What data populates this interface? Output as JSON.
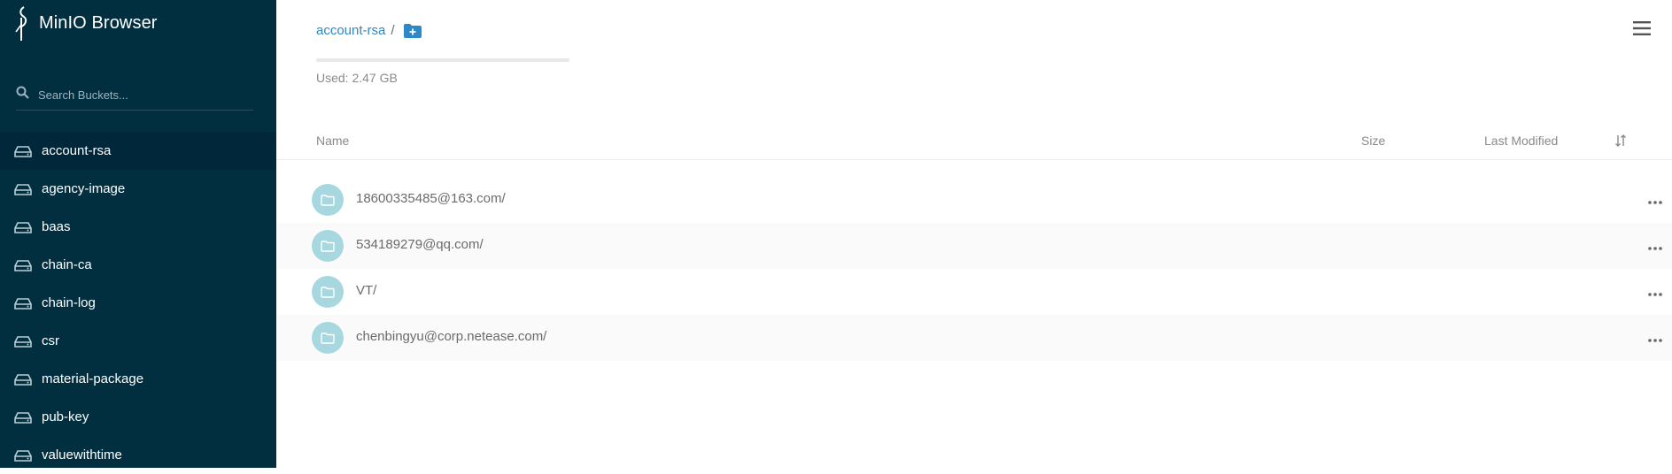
{
  "app": {
    "title": "MinIO Browser"
  },
  "search": {
    "placeholder": "Search Buckets..."
  },
  "sidebar": {
    "buckets": [
      {
        "label": "account-rsa",
        "active": true
      },
      {
        "label": "agency-image"
      },
      {
        "label": "baas"
      },
      {
        "label": "chain-ca"
      },
      {
        "label": "chain-log"
      },
      {
        "label": "csr"
      },
      {
        "label": "material-package"
      },
      {
        "label": "pub-key"
      },
      {
        "label": "valuewithtime"
      }
    ]
  },
  "breadcrumb": {
    "bucket": "account-rsa",
    "separator": "/"
  },
  "usage": {
    "text": "Used: 2.47 GB"
  },
  "table": {
    "headers": {
      "name": "Name",
      "size": "Size",
      "last_modified": "Last Modified"
    },
    "rows": [
      {
        "name": "18600335485@163.com/"
      },
      {
        "name": "534189279@qq.com/"
      },
      {
        "name": "VT/"
      },
      {
        "name": "chenbingyu@corp.netease.com/"
      }
    ]
  },
  "icons": {
    "logo": "minio-bird-icon",
    "search": "search-icon",
    "bucket": "bucket-drive-icon",
    "new_folder": "folder-plus-icon",
    "menu": "hamburger-menu-icon",
    "sort": "sort-icon",
    "folder": "folder-icon",
    "more": "more-dots-icon"
  },
  "colors": {
    "sidebar_bg": "#022f40",
    "accent": "#2e88c7",
    "folder_badge": "#a7d8e0"
  }
}
